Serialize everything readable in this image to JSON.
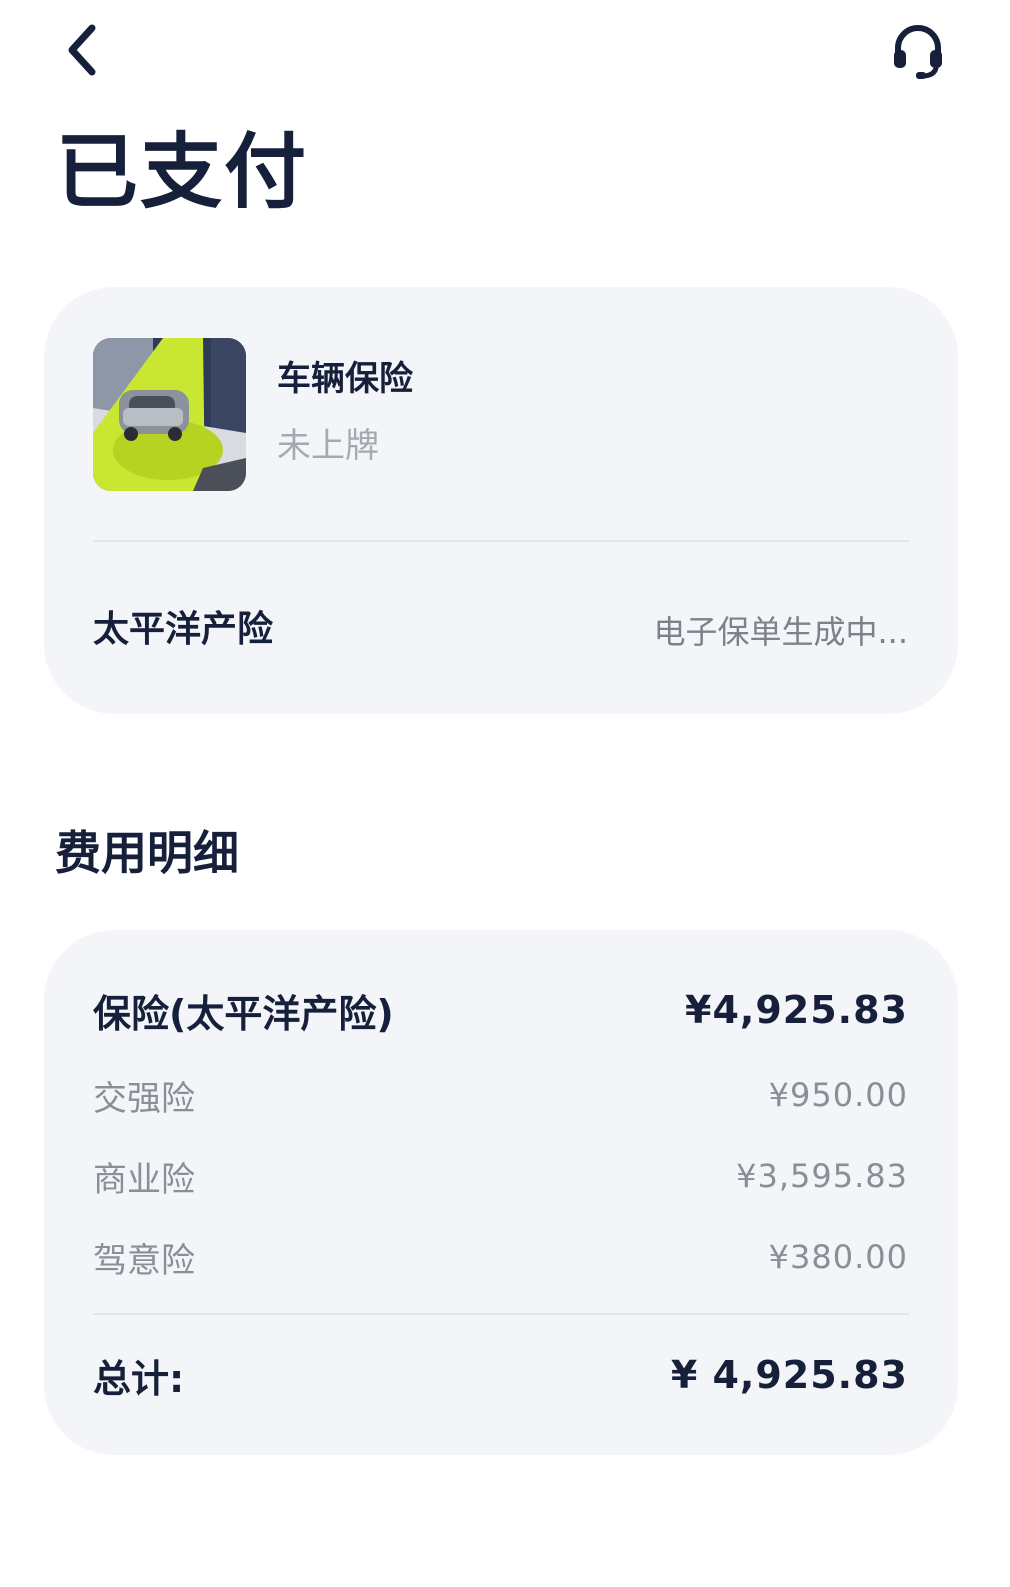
{
  "header": {
    "back_icon": "chevron-left-icon",
    "support_icon": "headset-icon",
    "title": "已支付"
  },
  "product_card": {
    "thumbnail": "car-thumbnail",
    "name": "车辆保险",
    "plate_status": "未上牌",
    "insurer": "太平洋产险",
    "policy_status": "电子保单生成中..."
  },
  "fee_section": {
    "title": "费用明细",
    "main_label": "保险(太平洋产险)",
    "main_amount": "¥4,925.83",
    "items": [
      {
        "label": "交强险",
        "amount": "¥950.00"
      },
      {
        "label": "商业险",
        "amount": "¥3,595.83"
      },
      {
        "label": "驾意险",
        "amount": "¥380.00"
      }
    ],
    "total_label": "总计:",
    "total_amount": "¥ 4,925.83"
  },
  "colors": {
    "primary_text": "#16203b",
    "secondary_text": "#8a8e98",
    "card_background": "#f4f5f8",
    "accent_yellow": "#c9e630"
  }
}
